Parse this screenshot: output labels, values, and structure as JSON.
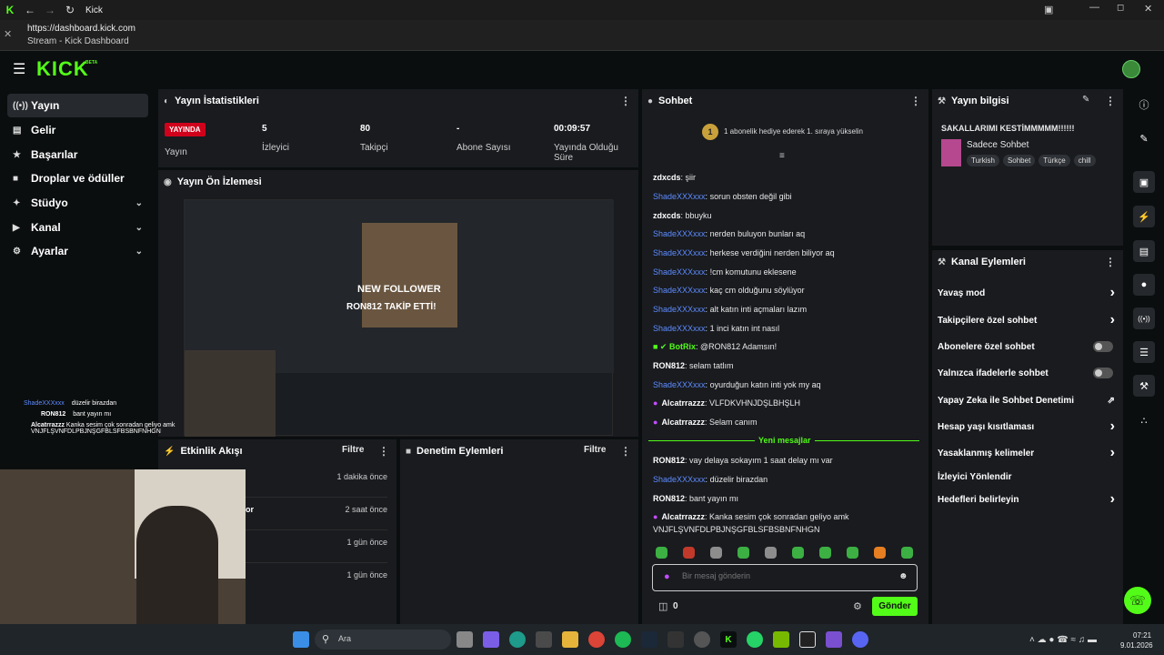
{
  "browser": {
    "title": "Kick",
    "url": "https://dashboard.kick.com",
    "page_title": "Stream - Kick Dashboard"
  },
  "app": {
    "logo": "KICK",
    "logo_badge": "BETA"
  },
  "sidebar": {
    "items": [
      {
        "label": "Yayın",
        "icon": "broadcast-icon"
      },
      {
        "label": "Gelir",
        "icon": "revenue-icon"
      },
      {
        "label": "Başarılar",
        "icon": "trophy-icon"
      },
      {
        "label": "Droplar ve ödüller",
        "icon": "gift-icon"
      },
      {
        "label": "Stüdyo",
        "icon": "studio-icon"
      },
      {
        "label": "Kanal",
        "icon": "channel-icon"
      },
      {
        "label": "Ayarlar",
        "icon": "gear-icon"
      }
    ]
  },
  "stats": {
    "title": "Yayın İstatistikleri",
    "live_badge": "YAYINDA",
    "live_label": "Yayın",
    "viewers": "5",
    "viewers_label": "İzleyici",
    "followers": "80",
    "followers_label": "Takipçi",
    "subs": "-",
    "subs_label": "Abone Sayısı",
    "duration": "00:09:57",
    "duration_label": "Yayında Olduğu Süre"
  },
  "preview": {
    "title": "Yayın Ön İzlemesi",
    "overlay_line1": "NEW FOLLOWER",
    "overlay_line2": "RON812 TAKİP ETTİ!"
  },
  "overlay_chat": [
    {
      "user": "ShadeXXXxxx",
      "text": "düzelir birazdan"
    },
    {
      "user": "RON812",
      "text": "bant yayın mı"
    },
    {
      "user": "Alcatrrazzz",
      "text": "Kanka sesim çok sonradan geliyo amk VNJFLŞVNFDLPBJNŞGFBLSFBSBNFNHGN"
    }
  ],
  "activity": {
    "title": "Etkinlik Akışı",
    "filter": "Filtre",
    "items": [
      {
        "name": "",
        "time": "1 dakika önce"
      },
      {
        "name": "or",
        "time": "2 saat önce"
      },
      {
        "name": "",
        "time": "1 gün önce"
      },
      {
        "name": "",
        "time": "1 gün önce"
      }
    ]
  },
  "moderation": {
    "title": "Denetim Eylemleri",
    "filter": "Filtre"
  },
  "chat": {
    "title": "Sohbet",
    "gift_banner": "1 abonelik hediye ederek 1. sıraya yükselin",
    "gift_rank": "1",
    "messages": [
      {
        "user": "zdxcds",
        "color": "white",
        "text": "şiir"
      },
      {
        "user": "ShadeXXXxxx",
        "color": "blue",
        "text": "sorun obsten değil gibi"
      },
      {
        "user": "zdxcds",
        "color": "white",
        "text": "bbuyku"
      },
      {
        "user": "ShadeXXXxxx",
        "color": "blue",
        "text": "nerden buluyon bunları aq"
      },
      {
        "user": "ShadeXXXxxx",
        "color": "blue",
        "text": "herkese verdiğini nerden biliyor aq"
      },
      {
        "user": "ShadeXXXxxx",
        "color": "blue",
        "text": "!cm komutunu eklesene"
      },
      {
        "user": "ShadeXXXxxx",
        "color": "blue",
        "text": "kaç cm olduğunu söylüyor"
      },
      {
        "user": "ShadeXXXxxx",
        "color": "blue",
        "text": "alt katın inti açmaları lazım"
      },
      {
        "user": "ShadeXXXxxx",
        "color": "blue",
        "text": "1 inci katın int nasıl"
      },
      {
        "user": "BotRix",
        "color": "green",
        "text": "@RON812 Adamsın!"
      },
      {
        "user": "RON812",
        "color": "white",
        "text": "selam tatlım"
      },
      {
        "user": "ShadeXXXxxx",
        "color": "blue",
        "text": "oyurduğun katın inti yok my aq"
      },
      {
        "user": "Alcatrrazzz",
        "color": "mic",
        "text": "VLFDKVHNJDŞLBHŞLH"
      },
      {
        "user": "Alcatrrazzz",
        "color": "mic",
        "text": "Selam canım"
      }
    ],
    "new_messages": "Yeni mesajlar",
    "new": [
      {
        "user": "RON812",
        "color": "white",
        "text": "vay delaya sokayım 1 saat delay mı var"
      },
      {
        "user": "ShadeXXXxxx",
        "color": "blue",
        "text": "düzelir birazdan"
      },
      {
        "user": "RON812",
        "color": "white",
        "text": "bant yayın mı"
      },
      {
        "user": "Alcatrrazzz",
        "color": "mic",
        "text": "Kanka sesim çok sonradan geliyo amk"
      }
    ],
    "wrap_line": "VNJFLŞVNFDLPBJNŞGFBLSFBSBNFNHGN",
    "placeholder": "Bir mesaj gönderin",
    "points": "0",
    "send": "Gönder"
  },
  "stream_info": {
    "title": "Yayın bilgisi",
    "stream_title": "SAKALLARIMI KESTİMMMMM!!!!!!",
    "category": "Sadece Sohbet",
    "tags": [
      "Turkish",
      "Sohbet",
      "Türkçe",
      "chill"
    ]
  },
  "channel_actions": {
    "title": "Kanal Eylemleri",
    "items": [
      {
        "label": "Yavaş mod",
        "type": "chev"
      },
      {
        "label": "Takipçilere özel sohbet",
        "type": "chev"
      },
      {
        "label": "Abonelere özel sohbet",
        "type": "toggle"
      },
      {
        "label": "Yalnızca ifadelerle sohbet",
        "type": "toggle"
      },
      {
        "label": "Yapay Zeka ile Sohbet Denetimi",
        "type": "ext"
      },
      {
        "label": "Hesap yaşı kısıtlaması",
        "type": "chev"
      },
      {
        "label": "Yasaklanmış kelimeler",
        "type": "chev"
      },
      {
        "label": "İzleyici Yönlendir",
        "type": "none"
      },
      {
        "label": "Hedefleri belirleyin",
        "type": "chev"
      }
    ]
  },
  "taskbar": {
    "search": "Ara",
    "time": "07:21",
    "date": "9.01.2026"
  },
  "colors": {
    "accent": "#53fc18",
    "live": "#d0021b",
    "panel": "#191b1f",
    "username_blue": "#5e8cff"
  }
}
